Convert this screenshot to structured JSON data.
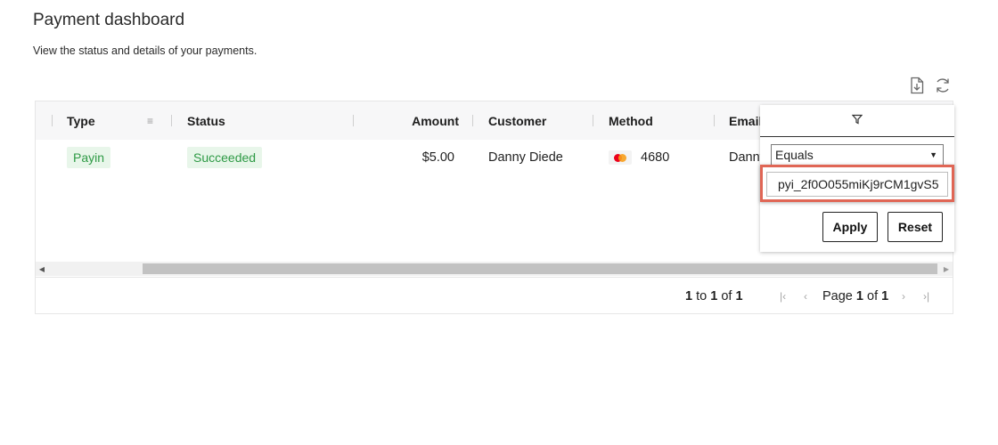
{
  "page": {
    "title": "Payment dashboard",
    "subtitle": "View the status and details of your payments."
  },
  "toolbar": {
    "export_icon": "download-file-icon",
    "refresh_icon": "refresh-icon"
  },
  "table": {
    "columns": [
      "Type",
      "Status",
      "Amount",
      "Customer",
      "Method",
      "Email"
    ],
    "rows": [
      {
        "type": "Payin",
        "status": "Succeeded",
        "amount": "$5.00",
        "customer": "Danny Diede",
        "method_icon": "mastercard-icon",
        "method_last4": "4680",
        "email": "Danny"
      }
    ],
    "colors": {
      "status_success_bg": "#e8f6ea",
      "status_success_text": "#2e9a45"
    }
  },
  "pagination": {
    "range_start": "1",
    "to_label": "to",
    "range_end": "1",
    "of_label": "of",
    "total": "1",
    "page_label": "Page",
    "current_page": "1",
    "page_of_label": "of",
    "total_pages": "1"
  },
  "filter": {
    "operator": "Equals",
    "value": "pyi_2f0O055miKj9rCM1gvS5",
    "apply_label": "Apply",
    "reset_label": "Reset",
    "highlight_color": "#e06655"
  }
}
